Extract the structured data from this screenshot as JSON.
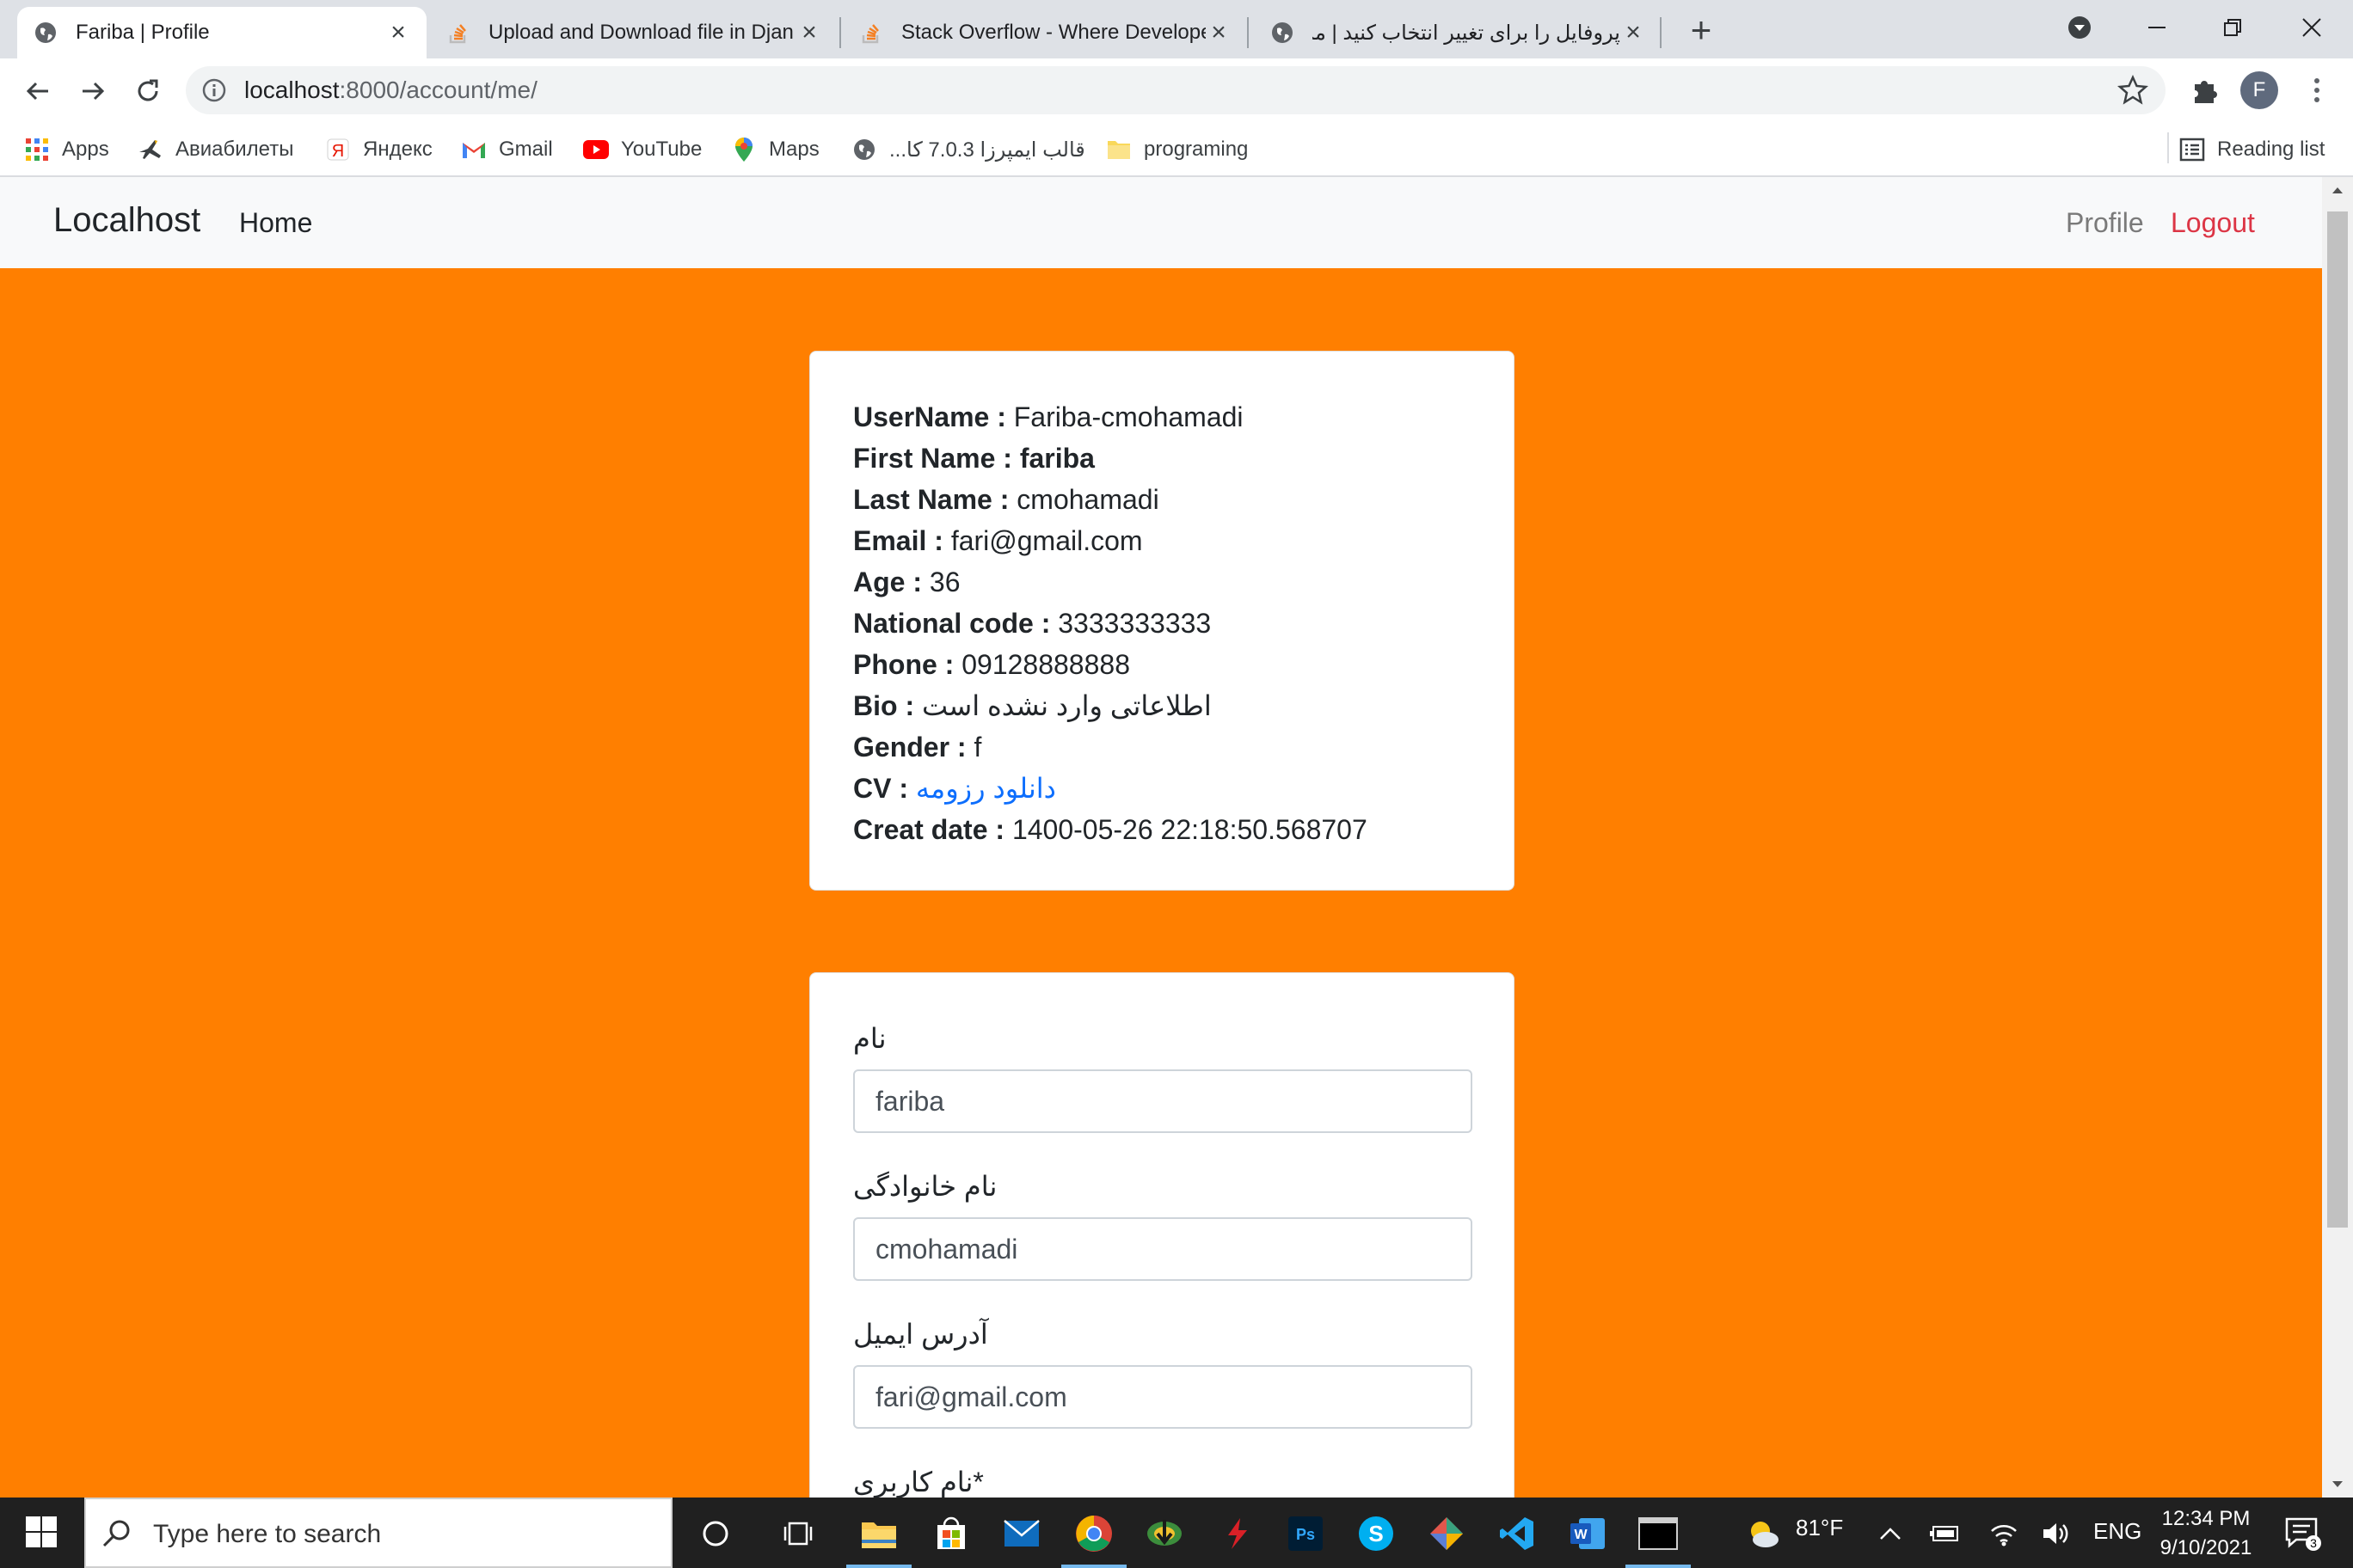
{
  "browser": {
    "tabs": [
      {
        "title": "Fariba | Profile",
        "icon": "globe-icon"
      },
      {
        "title": "Upload and Download file in Djan",
        "icon": "stackoverflow-icon"
      },
      {
        "title": "Stack Overflow - Where Develope",
        "icon": "stackoverflow-icon"
      },
      {
        "title": "پروفایل را برای تغییر انتخاب کنید | مد",
        "icon": "globe-icon"
      }
    ],
    "url_host": "localhost",
    "url_path": ":8000/account/me/",
    "profile_initial": "F",
    "bookmarks": [
      {
        "label": "Apps",
        "icon": "apps-grid-icon"
      },
      {
        "label": "Авиабилеты",
        "icon": "plane-icon"
      },
      {
        "label": "Яндекс",
        "icon": "yandex-icon"
      },
      {
        "label": "Gmail",
        "icon": "gmail-icon"
      },
      {
        "label": "YouTube",
        "icon": "youtube-icon"
      },
      {
        "label": "Maps",
        "icon": "maps-pin-icon"
      },
      {
        "label": "قالب ایمپرزا 7.0.3 کا...",
        "icon": "globe-icon"
      },
      {
        "label": "programing",
        "icon": "folder-icon"
      }
    ],
    "reading_list": "Reading list"
  },
  "navbar": {
    "brand": "Localhost",
    "home": "Home",
    "profile": "Profile",
    "logout": "Logout"
  },
  "profile_info": {
    "username_label": "UserName :",
    "username": "Fariba-cmohamadi",
    "first_name_label": "First Name :",
    "first_name": "fariba",
    "last_name_label": "Last Name :",
    "last_name": "cmohamadi",
    "email_label": "Email :",
    "email": "fari@gmail.com",
    "age_label": "Age :",
    "age": "36",
    "national_code_label": "National code :",
    "national_code": "3333333333",
    "phone_label": "Phone :",
    "phone": "09128888888",
    "bio_label": "Bio :",
    "bio": "اطلاعاتی وارد نشده است",
    "gender_label": "Gender :",
    "gender": "f",
    "cv_label": "CV :",
    "cv_link": "دانلود رزومه",
    "create_date_label": "Creat date :",
    "create_date": "1400-05-26 22:18:50.568707"
  },
  "form": {
    "first_name_label": "نام",
    "first_name_value": "fariba",
    "last_name_label": "نام خانوادگی",
    "last_name_value": "cmohamadi",
    "email_label": "آدرس ایمیل",
    "email_value": "fari@gmail.com",
    "username_label": "نام کاربری*"
  },
  "taskbar": {
    "search_placeholder": "Type here to search",
    "weather": "81°F",
    "language": "ENG",
    "time": "12:34 PM",
    "date": "9/10/2021",
    "notification_count": "3"
  },
  "colors": {
    "page_background": "#ff7f00",
    "navbar_background": "#f8f9fa",
    "logout": "#dc3545",
    "link": "#0d6efd"
  }
}
